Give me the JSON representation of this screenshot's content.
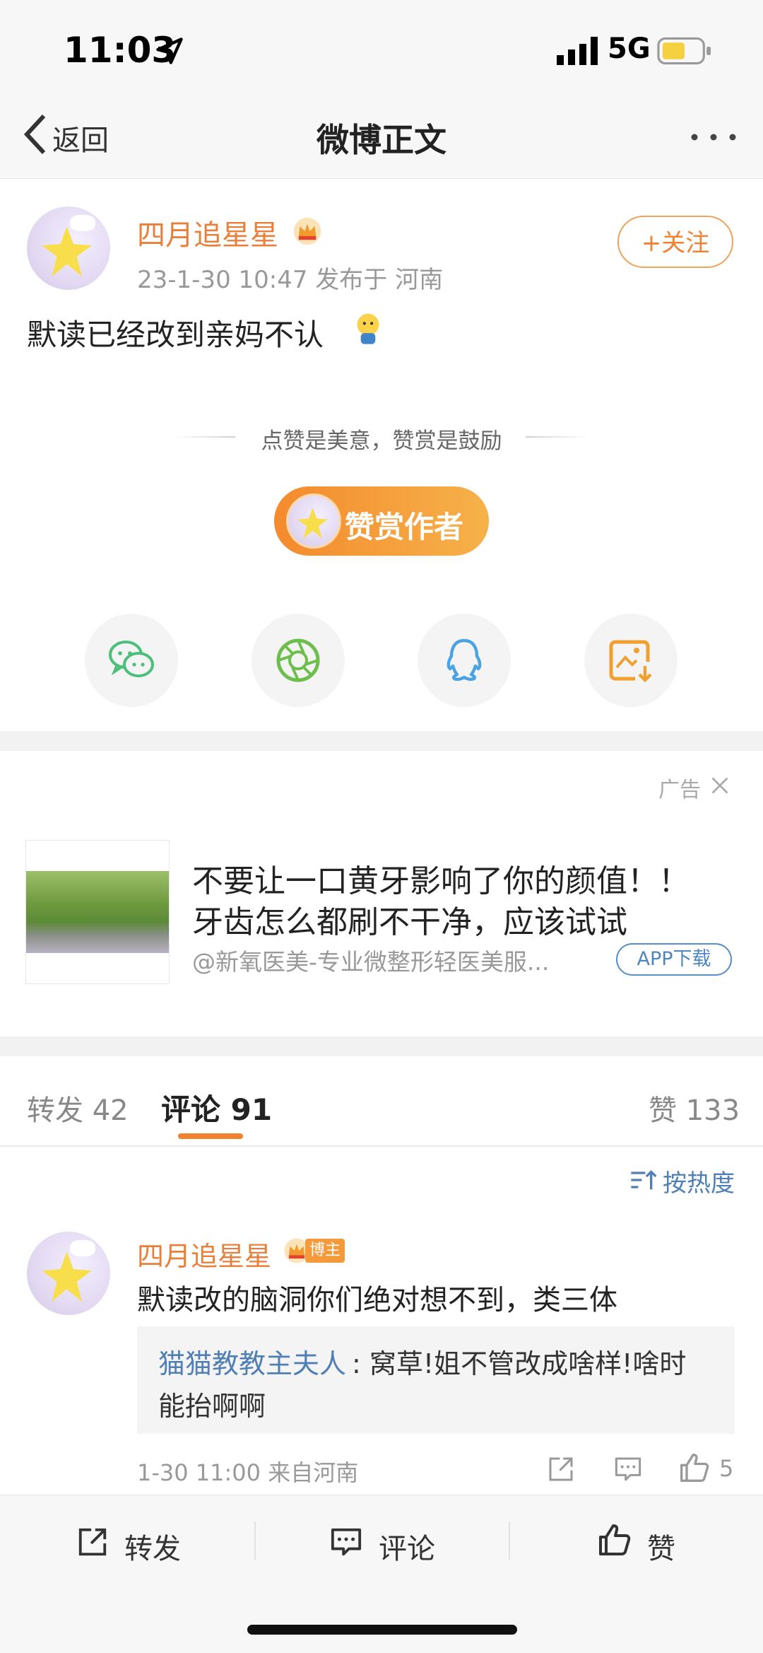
{
  "status_bar": {
    "time": "11:03",
    "network": "5G"
  },
  "nav": {
    "back_label": "返回",
    "title": "微博正文"
  },
  "post": {
    "author": "四月追星星",
    "meta": "23-1-30 10:47   发布于 河南",
    "follow_label": "+关注",
    "text": "默读已经改到亲妈不认"
  },
  "reward": {
    "slogan": "点赞是美意，赞赏是鼓励",
    "button_label": "赞赏作者"
  },
  "share_icons": [
    "wechat-icon",
    "moments-icon",
    "qq-icon",
    "save-image-icon"
  ],
  "ad": {
    "tag": "广告",
    "line1": "不要让一口黄牙影响了你的颜值！！",
    "line2": "牙齿怎么都刷不干净，应该试试",
    "source": "@新氧医美-专业微整形轻医美服...",
    "app_button": "APP下载"
  },
  "tabs": {
    "repost": "转发 42",
    "comment": "评论 91",
    "like": "赞 133"
  },
  "sort": {
    "label": "按热度"
  },
  "comment": {
    "author": "四月追星星",
    "badge": "博主",
    "text": "默读改的脑洞你们绝对想不到，类三体",
    "reply_name": "猫猫教教主夫人",
    "reply_text1": ": 窝草!姐不管改成啥样!啥时",
    "reply_text2": "能抬啊啊",
    "meta": "1-30 11:00  来自河南",
    "like_count": "5"
  },
  "bottom_bar": {
    "repost": "转发",
    "comment": "评论",
    "like": "赞"
  },
  "colors": {
    "accent": "#f08232",
    "link": "#4f7fb5",
    "author": "#e8803b"
  }
}
